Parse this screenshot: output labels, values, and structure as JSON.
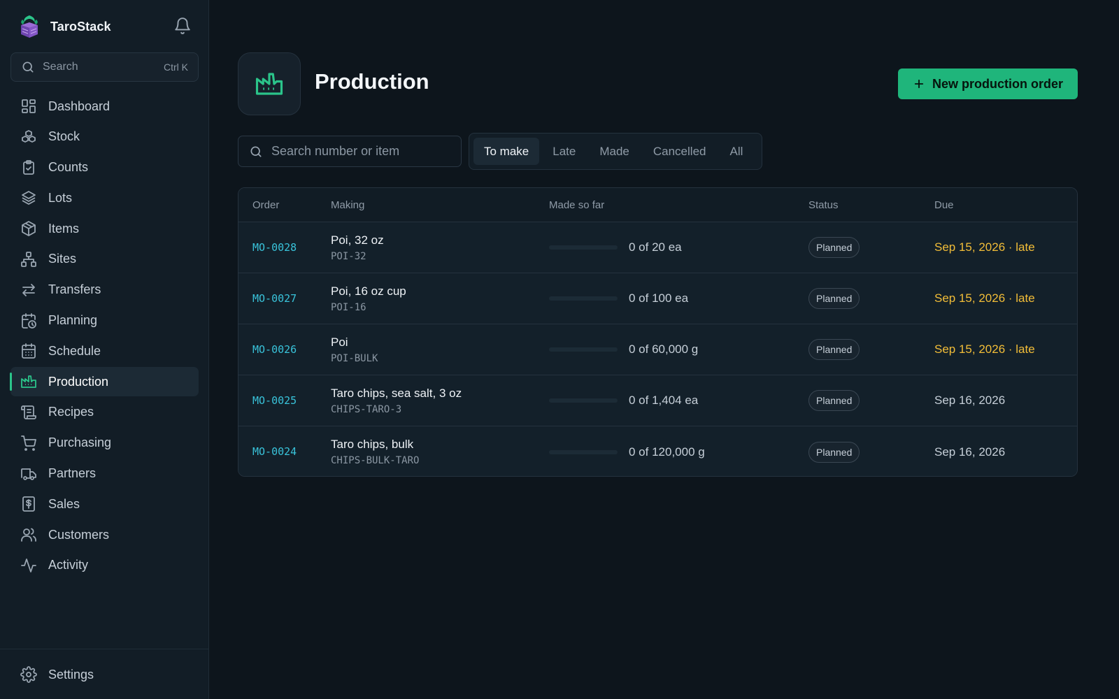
{
  "app": {
    "name": "TaroStack"
  },
  "sidebar": {
    "search": {
      "placeholder": "Search",
      "shortcut": "Ctrl K"
    },
    "items": [
      {
        "label": "Dashboard",
        "icon": "dashboard-icon"
      },
      {
        "label": "Stock",
        "icon": "boxes-icon"
      },
      {
        "label": "Counts",
        "icon": "clipboard-check-icon"
      },
      {
        "label": "Lots",
        "icon": "layers-icon"
      },
      {
        "label": "Items",
        "icon": "package-icon"
      },
      {
        "label": "Sites",
        "icon": "network-icon"
      },
      {
        "label": "Transfers",
        "icon": "arrows-swap-icon"
      },
      {
        "label": "Planning",
        "icon": "calendar-clock-icon"
      },
      {
        "label": "Schedule",
        "icon": "calendar-icon"
      },
      {
        "label": "Production",
        "icon": "factory-icon",
        "active": true
      },
      {
        "label": "Recipes",
        "icon": "scroll-icon"
      },
      {
        "label": "Purchasing",
        "icon": "cart-icon"
      },
      {
        "label": "Partners",
        "icon": "truck-icon"
      },
      {
        "label": "Sales",
        "icon": "dollar-receipt-icon"
      },
      {
        "label": "Customers",
        "icon": "users-icon"
      },
      {
        "label": "Activity",
        "icon": "activity-icon"
      }
    ],
    "settings": {
      "label": "Settings",
      "icon": "gear-icon"
    }
  },
  "page": {
    "title": "Production",
    "new_button": "New production order",
    "search_placeholder": "Search number or item",
    "tabs": [
      "To make",
      "Late",
      "Made",
      "Cancelled",
      "All"
    ],
    "active_tab": "To make"
  },
  "table": {
    "headers": [
      "Order",
      "Making",
      "Made so far",
      "Status",
      "Due"
    ],
    "rows": [
      {
        "order": "MO-0028",
        "item": "Poi, 32 oz",
        "sku": "POI-32",
        "made": "0 of 20 ea",
        "progress": 0,
        "status": "Planned",
        "due": "Sep 15, 2026 · late",
        "late": true
      },
      {
        "order": "MO-0027",
        "item": "Poi, 16 oz cup",
        "sku": "POI-16",
        "made": "0 of 100 ea",
        "progress": 0,
        "status": "Planned",
        "due": "Sep 15, 2026 · late",
        "late": true
      },
      {
        "order": "MO-0026",
        "item": "Poi",
        "sku": "POI-BULK",
        "made": "0 of 60,000 g",
        "progress": 0,
        "status": "Planned",
        "due": "Sep 15, 2026 · late",
        "late": true
      },
      {
        "order": "MO-0025",
        "item": "Taro chips, sea salt, 3 oz",
        "sku": "CHIPS-TARO-3",
        "made": "0 of 1,404 ea",
        "progress": 0,
        "status": "Planned",
        "due": "Sep 16, 2026",
        "late": false
      },
      {
        "order": "MO-0024",
        "item": "Taro chips, bulk",
        "sku": "CHIPS-BULK-TARO",
        "made": "0 of 120,000 g",
        "progress": 0,
        "status": "Planned",
        "due": "Sep 16, 2026",
        "late": false
      }
    ]
  },
  "colors": {
    "accent": "#2bc48a",
    "late": "#f2bd38",
    "link": "#39c3da"
  }
}
